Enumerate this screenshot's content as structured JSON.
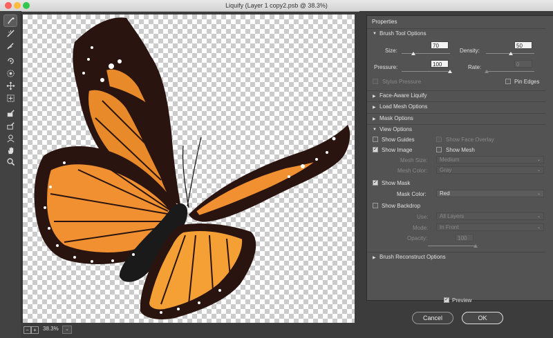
{
  "window": {
    "title": "Liquify (Layer 1 copy2.psb @ 38.3%)"
  },
  "colors": {
    "close": "#fc615d",
    "minimize": "#fdbc40",
    "maximize": "#34c84a",
    "panel_bg": "#535353"
  },
  "tools": [
    "forward-warp-tool-icon",
    "reconstruct-tool-icon",
    "smooth-tool-icon",
    "twirl-clockwise-tool-icon",
    "pucker-tool-icon",
    "bloat-tool-icon",
    "push-left-tool-icon",
    "freeze-mask-tool-icon",
    "thaw-mask-tool-icon",
    "face-tool-icon",
    "hand-tool-icon",
    "zoom-tool-icon"
  ],
  "status": {
    "zoom": "38.3%",
    "zoom_out": "−",
    "zoom_in": "+",
    "zoom_menu": "⌄"
  },
  "properties": {
    "title": "Properties",
    "brush": {
      "header": "Brush Tool Options",
      "size_label": "Size:",
      "size": 70,
      "density_label": "Density:",
      "density": 50,
      "pressure_label": "Pressure:",
      "pressure": 100,
      "rate_label": "Rate:",
      "rate": 0,
      "stylus_label": "Stylus Pressure",
      "pin_label": "Pin Edges"
    },
    "face_aware": "Face-Aware Liquify",
    "load_mesh": "Load Mesh Options",
    "mask_options": "Mask Options",
    "view": {
      "header": "View Options",
      "show_guides": "Show Guides",
      "show_face_overlay": "Show Face Overlay",
      "show_image": "Show Image",
      "show_mesh": "Show Mesh",
      "mesh_size_label": "Mesh Size:",
      "mesh_size": "Medium",
      "mesh_color_label": "Mesh Color:",
      "mesh_color": "Gray",
      "show_mask": "Show Mask",
      "mask_color_label": "Mask Color:",
      "mask_color": "Red",
      "show_backdrop": "Show Backdrop",
      "use_label": "Use:",
      "use": "All Layers",
      "mode_label": "Mode:",
      "mode": "In Front",
      "opacity_label": "Opacity:",
      "opacity": 100
    },
    "brush_reconstruct": "Brush Reconstruct Options"
  },
  "preview_label": "Preview",
  "cancel_label": "Cancel",
  "ok_label": "OK"
}
